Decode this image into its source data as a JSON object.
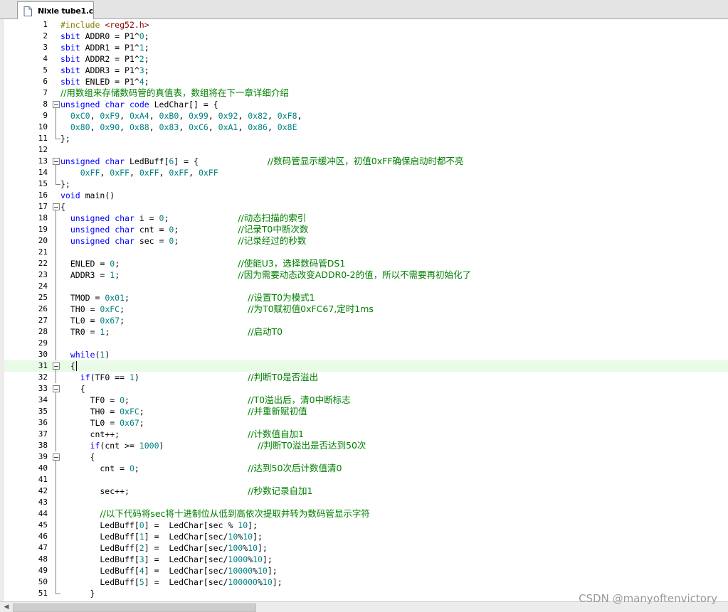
{
  "tab": {
    "title": "Nixie tube1.c",
    "icon": "document-icon"
  },
  "watermark": "CSDN @manyoftenvictory",
  "lines": [
    {
      "n": "1",
      "t": "#include <reg52.h>"
    },
    {
      "n": "2",
      "t": "sbit ADDR0 = P1^0;"
    },
    {
      "n": "3",
      "t": "sbit ADDR1 = P1^1;"
    },
    {
      "n": "4",
      "t": "sbit ADDR2 = P1^2;"
    },
    {
      "n": "5",
      "t": "sbit ADDR3 = P1^3;"
    },
    {
      "n": "6",
      "t": "sbit ENLED = P1^4;"
    },
    {
      "n": "7",
      "t": "//用数组来存储数码管的真值表，数组将在下一章详细介绍"
    },
    {
      "n": "8",
      "t": "unsigned char code LedChar[] = {"
    },
    {
      "n": "9",
      "t": "  0xC0, 0xF9, 0xA4, 0xB0, 0x99, 0x92, 0x82, 0xF8,"
    },
    {
      "n": "10",
      "t": "  0x80, 0x90, 0x88, 0x83, 0xC6, 0xA1, 0x86, 0x8E"
    },
    {
      "n": "11",
      "t": "};"
    },
    {
      "n": "12",
      "t": ""
    },
    {
      "n": "13",
      "t": "unsigned char LedBuff[6] = {              //数码管显示缓冲区，初值0xFF确保启动时都不亮"
    },
    {
      "n": "14",
      "t": "    0xFF, 0xFF, 0xFF, 0xFF, 0xFF"
    },
    {
      "n": "15",
      "t": "};"
    },
    {
      "n": "16",
      "t": "void main()"
    },
    {
      "n": "17",
      "t": "{"
    },
    {
      "n": "18",
      "t": "  unsigned char i = 0;              //动态扫描的索引"
    },
    {
      "n": "19",
      "t": "  unsigned char cnt = 0;            //记录T0中断次数"
    },
    {
      "n": "20",
      "t": "  unsigned char sec = 0;            //记录经过的秒数"
    },
    {
      "n": "21",
      "t": ""
    },
    {
      "n": "22",
      "t": "  ENLED = 0;                        //使能U3，选择数码管DS1"
    },
    {
      "n": "23",
      "t": "  ADDR3 = 1;                        //因为需要动态改变ADDR0-2的值，所以不需要再初始化了"
    },
    {
      "n": "24",
      "t": ""
    },
    {
      "n": "25",
      "t": "  TMOD = 0x01;                        //设置T0为模式1"
    },
    {
      "n": "26",
      "t": "  TH0 = 0xFC;                         //为T0赋初值0xFC67,定时1ms"
    },
    {
      "n": "27",
      "t": "  TL0 = 0x67;"
    },
    {
      "n": "28",
      "t": "  TR0 = 1;                            //启动T0"
    },
    {
      "n": "29",
      "t": ""
    },
    {
      "n": "30",
      "t": "  while(1)"
    },
    {
      "n": "31",
      "t": "  {"
    },
    {
      "n": "32",
      "t": "    if(TF0 == 1)                      //判断T0是否溢出"
    },
    {
      "n": "33",
      "t": "    {"
    },
    {
      "n": "34",
      "t": "      TF0 = 0;                        //T0溢出后，清0中断标志"
    },
    {
      "n": "35",
      "t": "      TH0 = 0xFC;                     //并重新赋初值"
    },
    {
      "n": "36",
      "t": "      TL0 = 0x67;"
    },
    {
      "n": "37",
      "t": "      cnt++;                          //计数值自加1"
    },
    {
      "n": "38",
      "t": "      if(cnt >= 1000)                   //判断T0溢出是否达到50次"
    },
    {
      "n": "39",
      "t": "      {"
    },
    {
      "n": "40",
      "t": "        cnt = 0;                      //达到50次后计数值清0"
    },
    {
      "n": "41",
      "t": ""
    },
    {
      "n": "42",
      "t": "        sec++;                        //秒数记录自加1"
    },
    {
      "n": "43",
      "t": ""
    },
    {
      "n": "44",
      "t": "        //以下代码将sec将十进制位从低到高依次提取并转为数码管显示字符"
    },
    {
      "n": "45",
      "t": "        LedBuff[0] =  LedChar[sec % 10];"
    },
    {
      "n": "46",
      "t": "        LedBuff[1] =  LedChar[sec/10%10];"
    },
    {
      "n": "47",
      "t": "        LedBuff[2] =  LedChar[sec/100%10];"
    },
    {
      "n": "48",
      "t": "        LedBuff[3] =  LedChar[sec/1000%10];"
    },
    {
      "n": "49",
      "t": "        LedBuff[4] =  LedChar[sec/10000%10];"
    },
    {
      "n": "50",
      "t": "        LedBuff[5] =  LedChar[sec/100000%10];"
    },
    {
      "n": "51",
      "t": "      }"
    }
  ],
  "highlighted_line": "31",
  "colors": {
    "keyword": "#0000ff",
    "number": "#008080",
    "comment": "#008000",
    "preprocessor": "#808000",
    "string": "#8b0000",
    "current_line_bg": "#e8fbe6"
  }
}
